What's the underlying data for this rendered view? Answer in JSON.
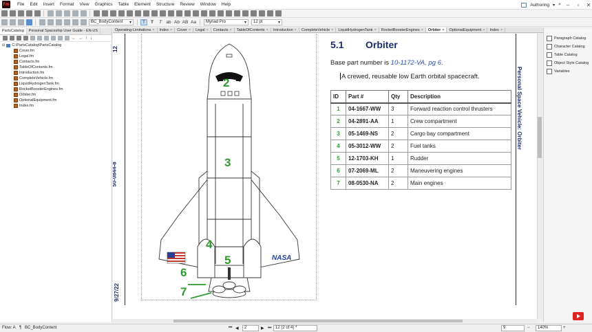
{
  "app": {
    "logo": "Fm",
    "menu": [
      "File",
      "Edit",
      "Insert",
      "Format",
      "View",
      "Graphics",
      "Table",
      "Element",
      "Structure",
      "Review",
      "Window",
      "Help"
    ],
    "workspace": "Authoring"
  },
  "format_bar": {
    "paragraph_tag": "BC_BodyContent",
    "font": "Myriad Pro",
    "size": "12 pt",
    "text_buttons": [
      "T",
      "T",
      "T",
      "ab",
      "Ab",
      "AB",
      "Aa"
    ]
  },
  "left_panel": {
    "tabs": [
      "PartsCatalog",
      "Personal Spaceship User Guide - EN-US"
    ],
    "root": "C:\\PartsCatalog\\PartsCatalog",
    "files": [
      "Cover.fm",
      "Legal.fm",
      "Contacts.fm",
      "TableOfContents.fm",
      "Introduction.fm",
      "CompleteVehicle.fm",
      "LiquidHydrogenTank.fm",
      "RocketBoosterEngines.fm",
      "Orbiter.fm",
      "OptionalEquipment.fm",
      "Index.fm"
    ]
  },
  "doc_tabs": [
    "Operating-Limitations",
    "Index",
    "Cover",
    "Legal",
    "Contacts",
    "TableOfContents",
    "Introduction",
    "CompleteVehicle",
    "LiquidHydrogenTank",
    "RocketBoosterEngines",
    "Orbiter",
    "OptionalEquipment",
    "Index"
  ],
  "active_doc_tab": "Orbiter",
  "page": {
    "margin_page_num": "12",
    "margin_doc_id": "50-0844-8",
    "margin_date": "9/27/22",
    "side_title": "Personal Space Vehicle: Orbiter",
    "section_number": "5.1",
    "section_title": "Orbiter",
    "base_part_prefix": "Base part number is ",
    "base_part_ref": "10-1172-VA, pg 6",
    "base_part_suffix": ".",
    "description": "A crewed, reusable low Earth orbital spacecraft.",
    "diagram_logo": "NASA",
    "callouts": [
      "2",
      "3",
      "4",
      "5",
      "6",
      "7"
    ]
  },
  "table": {
    "headers": [
      "ID",
      "Part #",
      "Qty",
      "Description"
    ],
    "rows": [
      [
        "1",
        "04-1667-WW",
        "3",
        "Forward reaction control thrusters"
      ],
      [
        "2",
        "04-2891-AA",
        "1",
        "Crew compartment"
      ],
      [
        "3",
        "05-1469-NS",
        "2",
        "Cargo bay compartment"
      ],
      [
        "4",
        "05-3012-WW",
        "2",
        "Fuel tanks"
      ],
      [
        "5",
        "12-1703-KH",
        "1",
        "Rudder"
      ],
      [
        "6",
        "07-2069-ML",
        "2",
        "Maneuvering engines"
      ],
      [
        "7",
        "08-0530-NA",
        "2",
        "Main engines"
      ]
    ]
  },
  "right_panel": {
    "items": [
      "Paragraph Catalog",
      "Character Catalog",
      "Table Catalog",
      "Object Style Catalog",
      "Variables"
    ]
  },
  "status": {
    "flow": "Flow: A",
    "tag": "BC_BodyContent",
    "page_field": "2",
    "page_info": "12 (2 of 4) *",
    "zoom_field": "9",
    "zoom": "140%"
  },
  "colors": {
    "heading_blue": "#1a2a6c",
    "callout_green": "#2e9a2e",
    "link_blue": "#2a4db8"
  }
}
